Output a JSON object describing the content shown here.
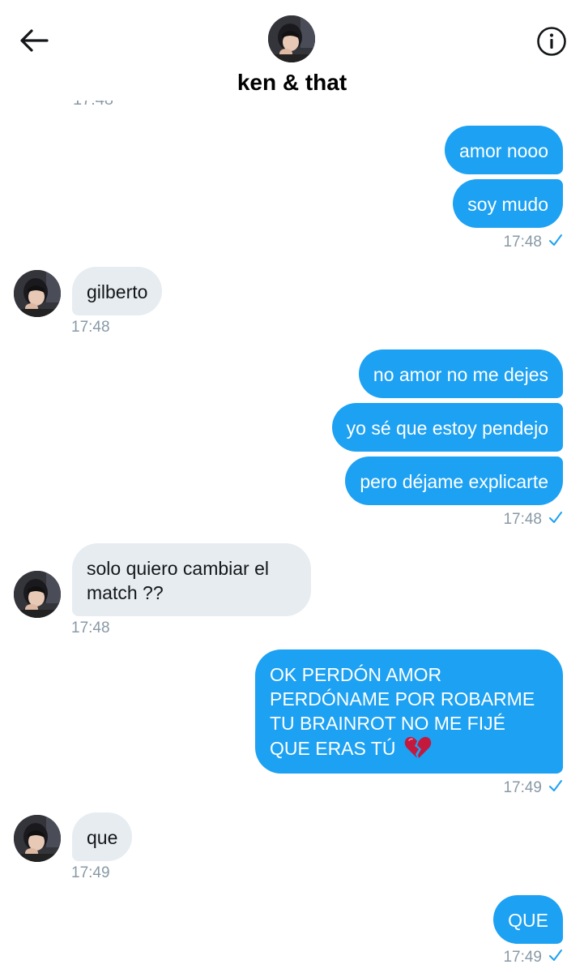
{
  "header": {
    "title": "ken & that",
    "back_icon": "arrow-left-icon",
    "info_icon": "info-icon"
  },
  "colors": {
    "outgoing_bubble": "#1da1f2",
    "incoming_bubble": "#e6ecf0",
    "timestamp": "#8899a6",
    "read_check": "#1da1f2"
  },
  "messages": {
    "m1": "amor nooo",
    "m2": "soy mudo",
    "t1": "17:48",
    "m3": "gilberto",
    "t2": "17:48",
    "m4": "no amor no me dejes",
    "m5": "yo sé que estoy pendejo",
    "m6": "pero déjame explicarte",
    "t3": "17:48",
    "m7_line1": "solo quiero cambiar el",
    "m7_line2": "match ??",
    "t4": "17:48",
    "m8_line1": "OK PERDÓN AMOR",
    "m8_line2": "PERDÓNAME POR ROBARME",
    "m8_line3": "TU BRAINROT NO ME FIJÉ",
    "m8_line4": "QUE ERAS TÚ",
    "m8_emoji": "💔",
    "t5": "17:49",
    "m9": "que",
    "t6": "17:49",
    "m10": "QUE",
    "t7": "17:49"
  },
  "read_check": "✓"
}
